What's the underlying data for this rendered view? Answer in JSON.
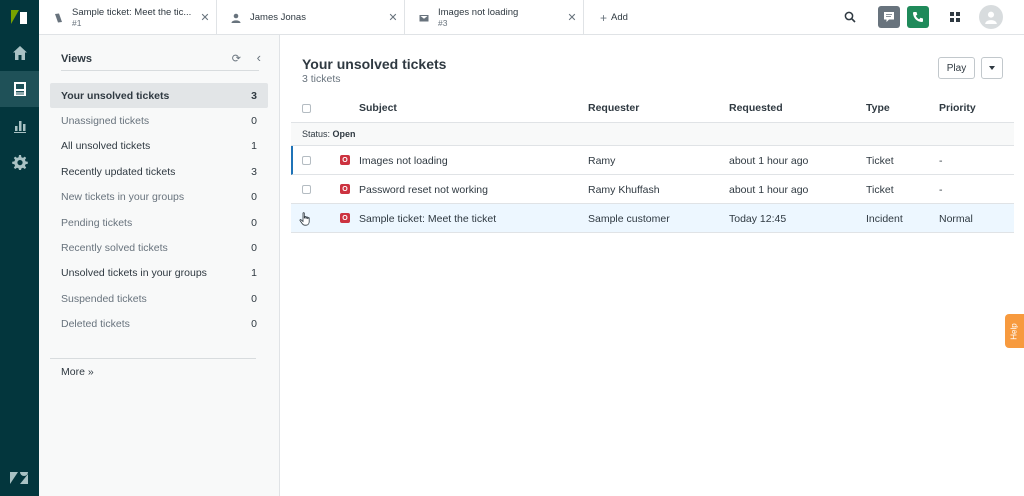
{
  "colors": {
    "rail": "#03363d",
    "accent": "#1f73b7",
    "badge": "#cc3340",
    "help": "#f79a3e",
    "chat": "#68737d",
    "phone": "#1f8a5a"
  },
  "rail": {
    "items": [
      {
        "icon": "home-icon"
      },
      {
        "icon": "views-icon"
      },
      {
        "icon": "reporting-icon"
      },
      {
        "icon": "admin-gear-icon"
      }
    ]
  },
  "tabs": [
    {
      "title": "Sample ticket: Meet the tic...",
      "sub": "#1",
      "icon": "ticket-icon"
    },
    {
      "title": "James Jonas",
      "sub": "",
      "icon": "user-icon"
    },
    {
      "title": "Images not loading",
      "sub": "#3",
      "icon": "mail-icon"
    }
  ],
  "add_tab": "Add",
  "views": {
    "title": "Views",
    "items": [
      {
        "label": "Your unsolved tickets",
        "count": "3"
      },
      {
        "label": "Unassigned tickets",
        "count": "0"
      },
      {
        "label": "All unsolved tickets",
        "count": "1"
      },
      {
        "label": "Recently updated tickets",
        "count": "3"
      },
      {
        "label": "New tickets in your groups",
        "count": "0"
      },
      {
        "label": "Pending tickets",
        "count": "0"
      },
      {
        "label": "Recently solved tickets",
        "count": "0"
      },
      {
        "label": "Unsolved tickets in your groups",
        "count": "1"
      },
      {
        "label": "Suspended tickets",
        "count": "0"
      },
      {
        "label": "Deleted tickets",
        "count": "0"
      }
    ],
    "more": "More »"
  },
  "main": {
    "title": "Your unsolved tickets",
    "subtitle": "3 tickets",
    "play_label": "Play",
    "columns": [
      "Subject",
      "Requester",
      "Requested",
      "Type",
      "Priority"
    ],
    "group_label": "Status:",
    "group_value": "Open",
    "rows": [
      {
        "status": "O",
        "subject": "Images not loading",
        "requester": "Ramy",
        "requested": "about 1 hour ago",
        "type": "Ticket",
        "priority": "-"
      },
      {
        "status": "O",
        "subject": "Password reset not working",
        "requester": "Ramy Khuffash",
        "requested": "about 1 hour ago",
        "type": "Ticket",
        "priority": "-"
      },
      {
        "status": "O",
        "subject": "Sample ticket: Meet the ticket",
        "requester": "Sample customer",
        "requested": "Today 12:45",
        "type": "Incident",
        "priority": "Normal"
      }
    ]
  },
  "help_label": "Help"
}
